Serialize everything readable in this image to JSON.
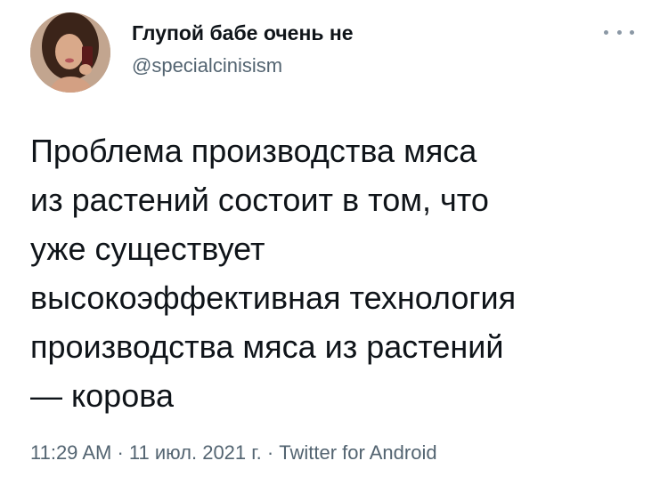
{
  "author": {
    "display_name": "Глупой бабе очень не",
    "handle": "@specialcinisism",
    "avatar_icon": "profile-photo"
  },
  "more_icon": "more-horizontal-icon",
  "tweet": {
    "text": "Проблема производства мяса\nиз растений состоит в том, что\nуже существует\nвысокоэффективная технология\nпроизводства мяса из растений\n— корова"
  },
  "meta": {
    "time": "11:29 AM",
    "separator1": " · ",
    "date": "11 июл. 2021 г.",
    "separator2": " · ",
    "source": "Twitter for Android"
  },
  "colors": {
    "text": "#0f1419",
    "secondary": "#536471",
    "background": "#ffffff"
  }
}
